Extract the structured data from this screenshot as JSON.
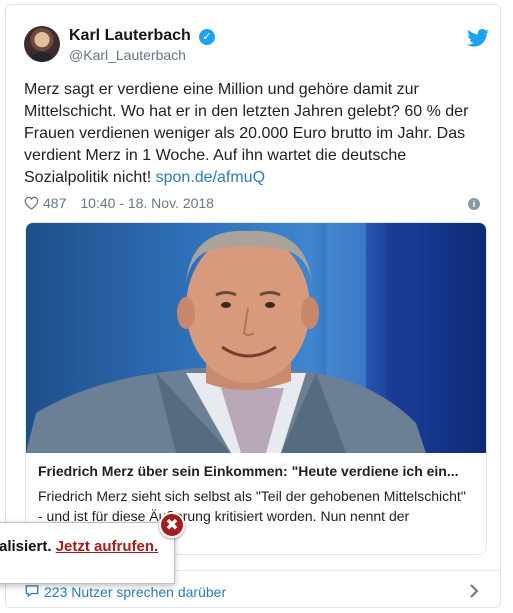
{
  "tweet": {
    "author_name": "Karl Lauterbach",
    "author_handle": "@Karl_Lauterbach",
    "verified_glyph": "✓",
    "text_main": "Merz sagt er verdiene eine Million und gehöre damit zur Mittelschicht. Wo hat er in den letzten Jahren gelebt? 60 % der Frauen verdienen weniger als 20.000 Euro brutto im Jahr. Das verdient Merz in 1 Woche. Auf ihn wartet die deutsche Sozialpolitik nicht! ",
    "text_link": "spon.de/afmuQ",
    "likes": "487",
    "timestamp": "10:40 - 18. Nov. 2018",
    "info_glyph": "i"
  },
  "link_card": {
    "title": "Friedrich Merz über sein Einkommen: \"Heute verdiene ich ein...",
    "description": "Friedrich Merz sieht sich selbst als \"Teil der gehobenen Mittelschicht\" - und ist für diese Äußerung kritisiert worden. Nun nennt der"
  },
  "footer": {
    "text": "223 Nutzer sprechen darüber"
  },
  "popup": {
    "text_prefix": "alisiert. ",
    "link_text": "Jetzt aufrufen.",
    "close_glyph": "✖"
  },
  "icons": {
    "twitter": "twitter-bird-icon",
    "heart": "heart-icon",
    "info": "info-icon",
    "comment": "comment-icon",
    "chevron": "chevron-right-icon",
    "close": "close-icon"
  },
  "colors": {
    "twitter_blue": "#1da1f2",
    "link_blue": "#2b7bb9",
    "popup_red": "#a61b1b",
    "meta_gray": "#697882"
  }
}
